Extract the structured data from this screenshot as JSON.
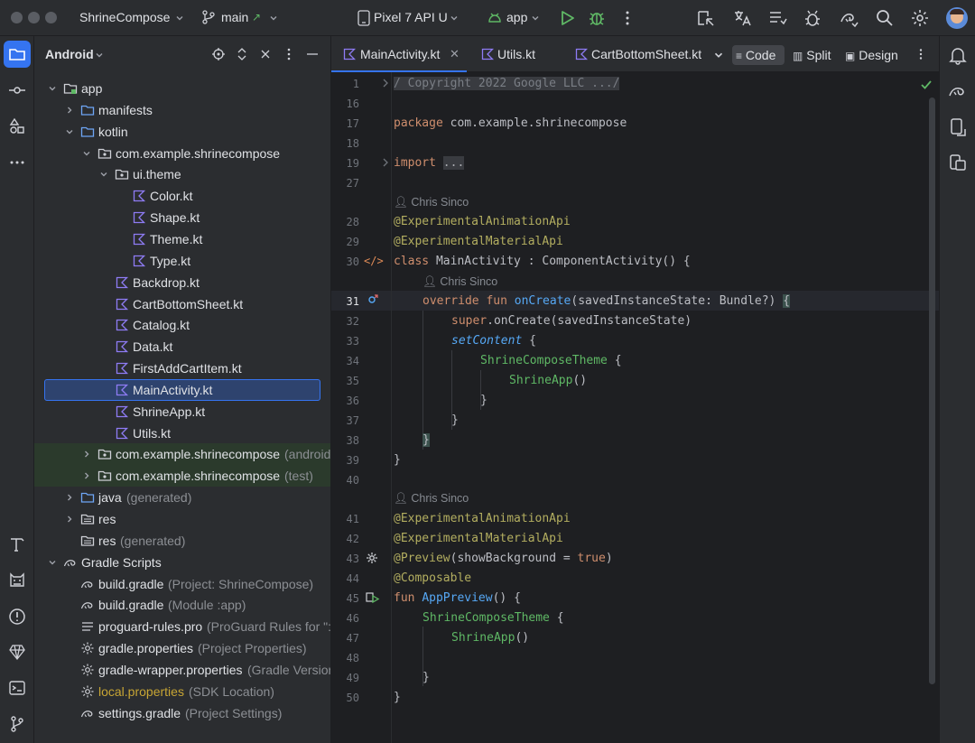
{
  "titlebar": {
    "project": "ShrineCompose",
    "branch": "main",
    "device": "Pixel 7 API U",
    "run_config": "app"
  },
  "sidebar": {
    "title": "Android"
  },
  "tree": [
    {
      "label": "app",
      "sub": "",
      "icon": "module-folder-icon"
    },
    {
      "label": "manifests",
      "sub": "",
      "icon": "folder-icon"
    },
    {
      "label": "kotlin",
      "sub": "",
      "icon": "folder-icon"
    },
    {
      "label": "com.example.shrinecompose",
      "sub": "",
      "icon": "package-icon"
    },
    {
      "label": "ui.theme",
      "sub": "",
      "icon": "package-icon"
    },
    {
      "label": "Color.kt",
      "sub": "",
      "icon": "kotlin-file-icon"
    },
    {
      "label": "Shape.kt",
      "sub": "",
      "icon": "kotlin-file-icon"
    },
    {
      "label": "Theme.kt",
      "sub": "",
      "icon": "kotlin-file-icon"
    },
    {
      "label": "Type.kt",
      "sub": "",
      "icon": "kotlin-file-icon"
    },
    {
      "label": "Backdrop.kt",
      "sub": "",
      "icon": "kotlin-file-icon"
    },
    {
      "label": "CartBottomSheet.kt",
      "sub": "",
      "icon": "kotlin-file-icon"
    },
    {
      "label": "Catalog.kt",
      "sub": "",
      "icon": "kotlin-file-icon"
    },
    {
      "label": "Data.kt",
      "sub": "",
      "icon": "kotlin-file-icon"
    },
    {
      "label": "FirstAddCartItem.kt",
      "sub": "",
      "icon": "kotlin-file-icon"
    },
    {
      "label": "MainActivity.kt",
      "sub": "",
      "icon": "kotlin-file-icon"
    },
    {
      "label": "ShrineApp.kt",
      "sub": "",
      "icon": "kotlin-file-icon"
    },
    {
      "label": "Utils.kt",
      "sub": "",
      "icon": "kotlin-file-icon"
    },
    {
      "label": "com.example.shrinecompose",
      "sub": "(androidT",
      "icon": "package-icon"
    },
    {
      "label": "com.example.shrinecompose",
      "sub": "(test)",
      "icon": "package-icon"
    },
    {
      "label": "java",
      "sub": "(generated)",
      "icon": "folder-icon"
    },
    {
      "label": "res",
      "sub": "",
      "icon": "res-folder-icon"
    },
    {
      "label": "res",
      "sub": "(generated)",
      "icon": "res-folder-icon"
    },
    {
      "label": "Gradle Scripts",
      "sub": "",
      "icon": "gradle-icon"
    },
    {
      "label": "build.gradle",
      "sub": "(Project: ShrineCompose)",
      "icon": "gradle-icon"
    },
    {
      "label": "build.gradle",
      "sub": "(Module :app)",
      "icon": "gradle-icon"
    },
    {
      "label": "proguard-rules.pro",
      "sub": "(ProGuard Rules for \":a",
      "icon": "text-file-icon"
    },
    {
      "label": "gradle.properties",
      "sub": "(Project Properties)",
      "icon": "settings-file-icon"
    },
    {
      "label": "gradle-wrapper.properties",
      "sub": "(Gradle Version",
      "icon": "settings-file-icon"
    },
    {
      "label": "local.properties",
      "sub": "(SDK Location)",
      "icon": "settings-file-icon"
    },
    {
      "label": "settings.gradle",
      "sub": "(Project Settings)",
      "icon": "gradle-icon"
    }
  ],
  "tabs": [
    {
      "label": "MainActivity.kt",
      "active": true
    },
    {
      "label": "Utils.kt",
      "active": false
    },
    {
      "label": "CartBottomSheet.kt",
      "active": false
    }
  ],
  "view_modes": {
    "code": "Code",
    "split": "Split",
    "design": "Design"
  },
  "editor": {
    "line_numbers": [
      "1",
      "16",
      "17",
      "18",
      "19",
      "27",
      "28",
      "29",
      "30",
      "31",
      "32",
      "33",
      "34",
      "35",
      "36",
      "37",
      "38",
      "39",
      "40",
      "41",
      "42",
      "43",
      "44",
      "45",
      "46",
      "47",
      "48",
      "49",
      "50"
    ],
    "author_hint": "Chris Sinco",
    "copyright_fold": "/ Copyright 2022 Google LLC .../",
    "package_kw": "package",
    "package_name": "com.example.shrinecompose",
    "import_kw": "import",
    "import_fold": "...",
    "ann_animation": "@ExperimentalAnimationApi",
    "ann_material": "@ExperimentalMaterialApi",
    "class_kw": "class",
    "class_decl": "MainActivity : ComponentActivity() {",
    "override_kw": "override fun",
    "oncreate_fn": "onCreate",
    "oncreate_params": "(savedInstanceState: Bundle?)",
    "brace_open": "{",
    "super_kw": "super",
    "super_call": ".onCreate(savedInstanceState)",
    "setcontent_fn": "setContent",
    "theme_call": "ShrineComposeTheme",
    "app_call": "ShrineApp",
    "parens": "()",
    "brace_close": "}",
    "preview_ann": "@Preview",
    "preview_args_a": "(showBackground = ",
    "preview_true": "true",
    "preview_args_b": ")",
    "composable_ann": "@Composable",
    "fun_kw": "fun",
    "apppreview_fn": "AppPreview",
    "apppreview_rest": "() {"
  }
}
